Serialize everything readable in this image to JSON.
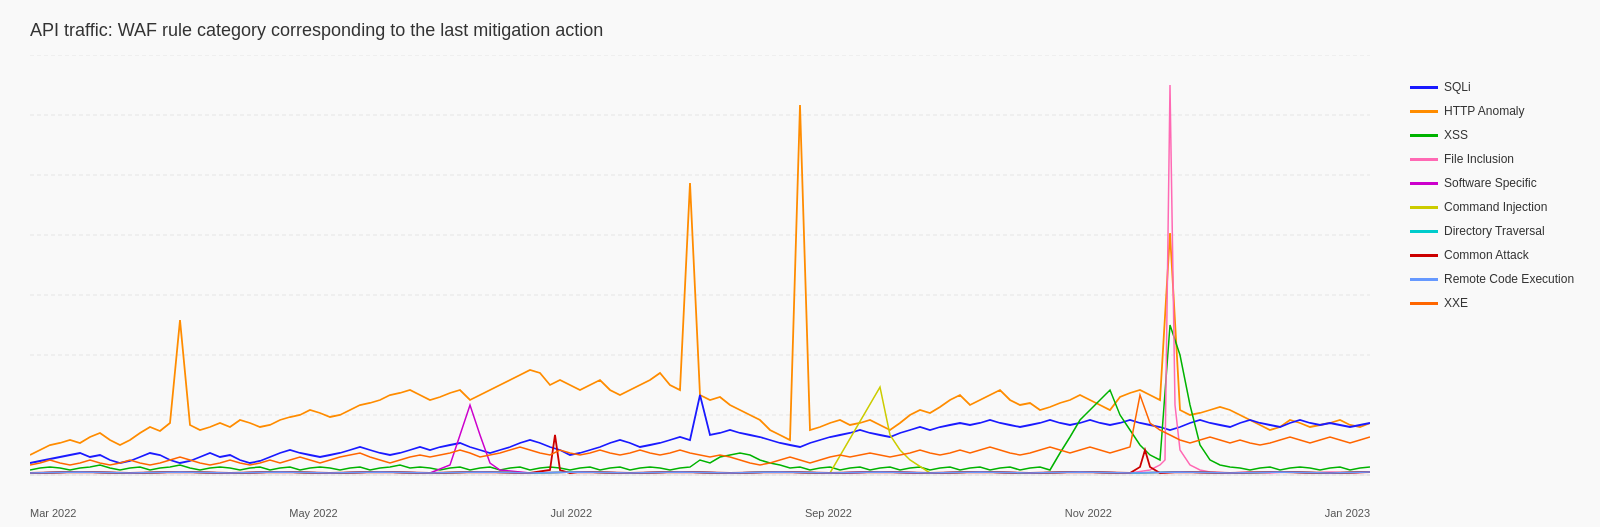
{
  "title": "API traffic: WAF rule category corresponding to the last mitigation action",
  "legend": {
    "items": [
      {
        "label": "SQLi",
        "color": "#1a1aff"
      },
      {
        "label": "HTTP Anomaly",
        "color": "#ff8c00"
      },
      {
        "label": "XSS",
        "color": "#00b300"
      },
      {
        "label": "File Inclusion",
        "color": "#ff69b4"
      },
      {
        "label": "Software Specific",
        "color": "#cc00cc"
      },
      {
        "label": "Command Injection",
        "color": "#cccc00"
      },
      {
        "label": "Directory Traversal",
        "color": "#00cccc"
      },
      {
        "label": "Common Attack",
        "color": "#cc0000"
      },
      {
        "label": "Remote Code Execution",
        "color": "#6699ff"
      },
      {
        "label": "XXE",
        "color": "#ff6600"
      }
    ]
  },
  "xLabels": [
    "Mar 2022",
    "May 2022",
    "Jul 2022",
    "Sep 2022",
    "Nov 2022",
    "Jan 2023"
  ]
}
